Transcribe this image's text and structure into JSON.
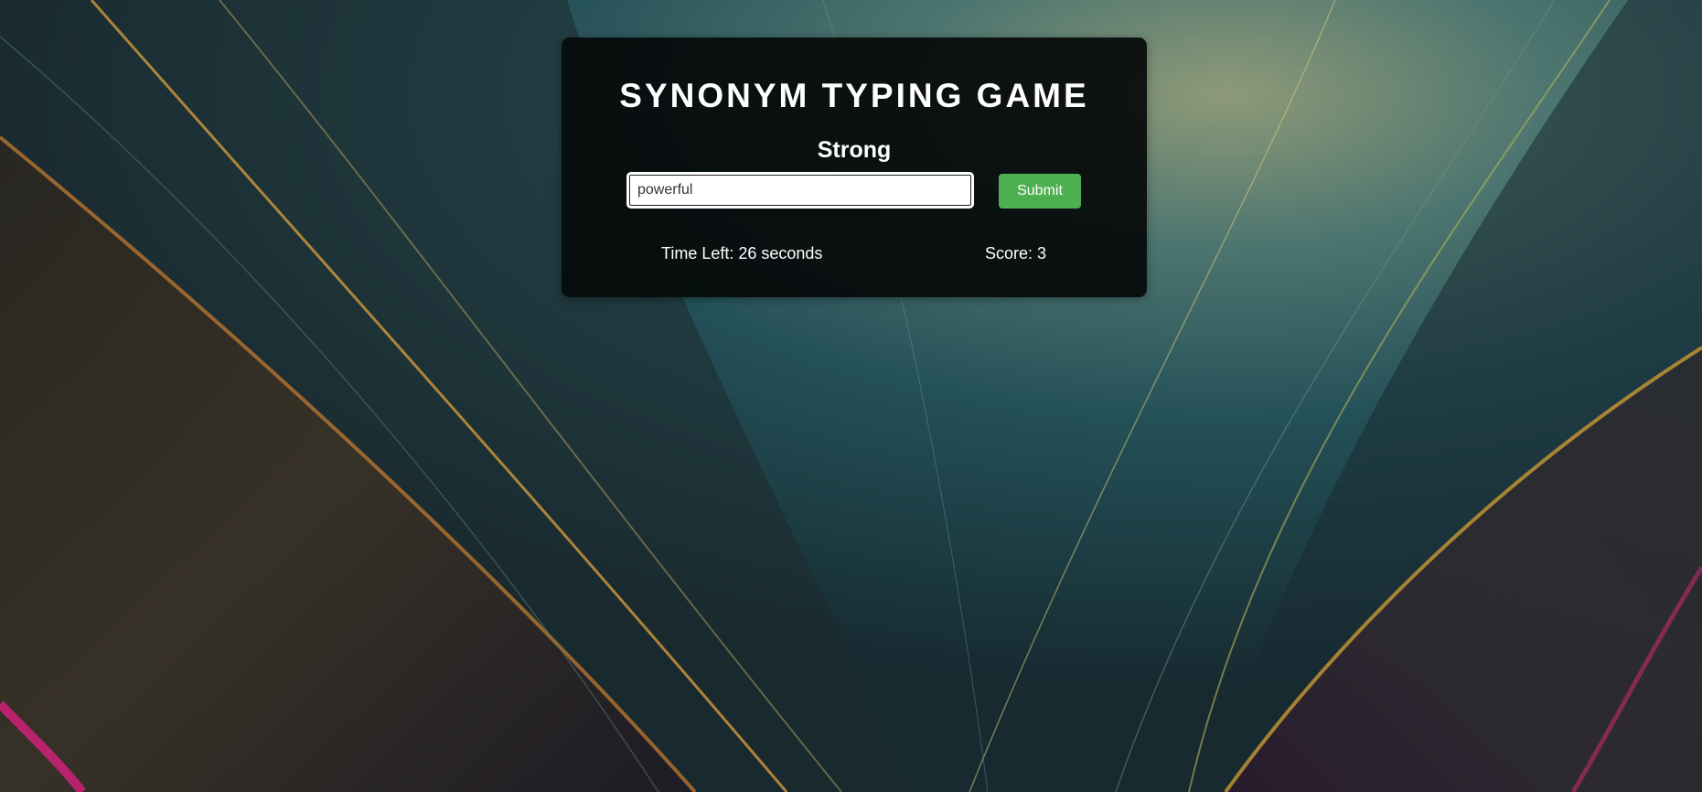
{
  "game": {
    "title": "SYNONYM TYPING GAME",
    "prompt_word": "Strong",
    "answer_value": "powerful",
    "submit_label": "Submit",
    "time_left_text": "Time Left: 26 seconds",
    "score_text": "Score: 3"
  },
  "colors": {
    "submit_button": "#4caf50",
    "card_background": "#060a0a",
    "text": "#ffffff"
  }
}
